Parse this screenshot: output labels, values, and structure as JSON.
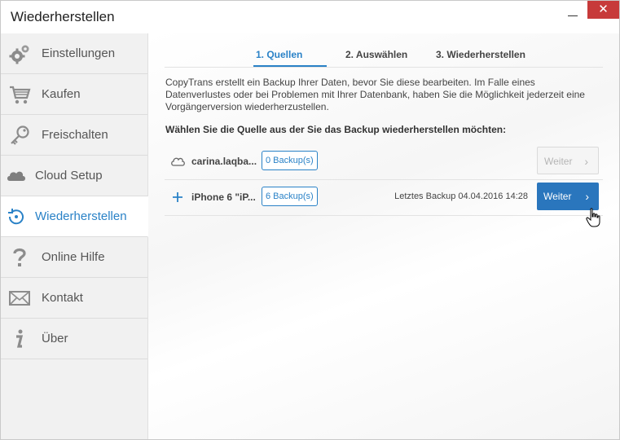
{
  "window": {
    "title": "Wiederherstellen",
    "close_glyph": "✕"
  },
  "sidebar": {
    "items": [
      {
        "label": "Einstellungen",
        "icon": "gear-icon"
      },
      {
        "label": "Kaufen",
        "icon": "cart-icon"
      },
      {
        "label": "Freischalten",
        "icon": "key-icon"
      },
      {
        "label": "Cloud Setup",
        "icon": "cloud-icon"
      },
      {
        "label": "Wiederherstellen",
        "icon": "restore-icon",
        "active": true
      },
      {
        "label": "Online Hilfe",
        "icon": "question-icon"
      },
      {
        "label": "Kontakt",
        "icon": "mail-icon"
      },
      {
        "label": "Über",
        "icon": "info-icon"
      }
    ]
  },
  "steps": [
    {
      "label": "1. Quellen",
      "active": true
    },
    {
      "label": "2. Auswählen"
    },
    {
      "label": "3. Wiederherstellen"
    }
  ],
  "content": {
    "description": "CopyTrans erstellt ein Backup Ihrer Daten, bevor Sie diese bearbeiten. Im Falle eines Datenverlustes oder bei Problemen mit Ihrer Datenbank, haben Sie die Möglichkeit jederzeit eine Vorgängerversion wiederherzustellen.",
    "prompt": "Wählen Sie die Quelle aus der Sie das Backup wiederherstellen möchten:"
  },
  "sources": [
    {
      "name": "carina.laqba...",
      "backups": "0 Backup(s)",
      "last_backup": "",
      "button": "Weiter",
      "enabled": false,
      "icon": "cloud-icon"
    },
    {
      "name": "iPhone 6 \"iP...",
      "backups": "6 Backup(s)",
      "last_backup": "Letztes Backup 04.04.2016 14:28",
      "button": "Weiter",
      "enabled": true,
      "icon": "plus-icon"
    }
  ],
  "colors": {
    "accent": "#2a82c7",
    "button_blue": "#2a76bd",
    "close_red": "#c73a3a"
  }
}
